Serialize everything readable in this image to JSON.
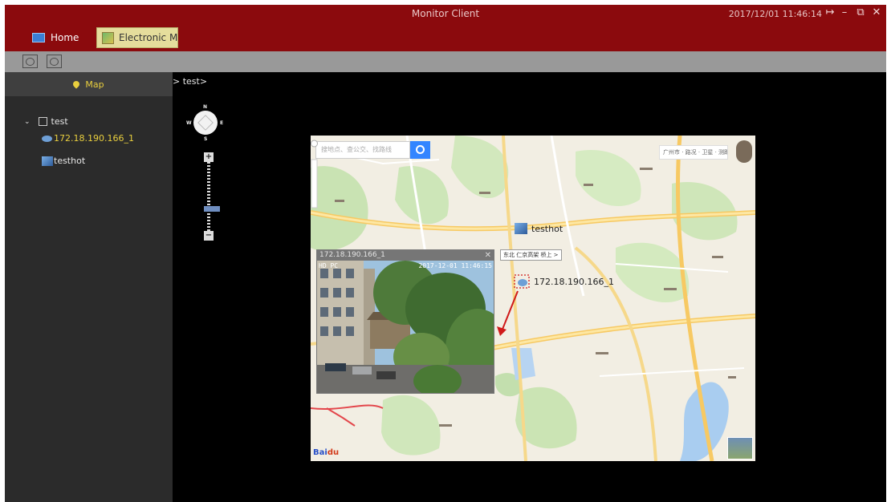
{
  "app": {
    "title": "Monitor Client",
    "datetime": "2017/12/01 11:46:14",
    "window_controls": [
      "logout-icon",
      "minimize-icon",
      "restore-icon",
      "close-icon"
    ],
    "colors": {
      "titlebar": "#8b0a0d",
      "accent": "#e9cf3e",
      "active_tab": "#e5dd9c"
    }
  },
  "tabs": [
    {
      "label": "Home",
      "icon": "monitor-icon"
    },
    {
      "label": "Electronic Map",
      "icon": "map-icon",
      "active": true
    }
  ],
  "toolbar": {
    "tools": [
      "map-search-tool-icon",
      "map-edit-tool-icon"
    ]
  },
  "sidebar": {
    "header": "Map",
    "tree": {
      "root": {
        "label": "test",
        "expanded": true
      },
      "items": [
        {
          "label": "172.18.190.166_1",
          "type": "camera",
          "selected": true
        },
        {
          "label": "testhot",
          "type": "hotspot"
        }
      ]
    }
  },
  "main": {
    "breadcrumb": "> test>",
    "compass": {
      "n": "N",
      "s": "S",
      "e": "E",
      "w": "W"
    },
    "zoom": {
      "plus": "+",
      "minus": "−",
      "level": 0.7
    }
  },
  "map": {
    "search_placeholder": "搜地点、查公交、找路线",
    "top_right": "广州市 · 路况 · 卫星 · 测距",
    "hotspot_label": "testhot",
    "camera_label": "172.18.190.166_1",
    "tooltip": "东北 仁京高架 桥上 >",
    "baidu_logo": "Bai",
    "baidu_logo_b": "du"
  },
  "video": {
    "title": "172.18.190.166_1",
    "osd_left": "HD  PC",
    "osd_time": "2017-12-01 11:46:15"
  }
}
